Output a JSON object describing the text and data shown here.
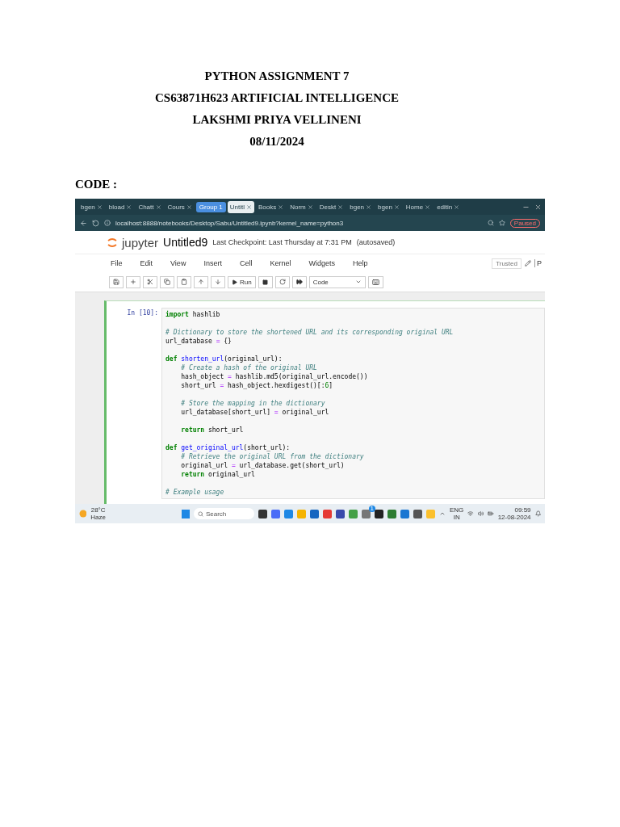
{
  "document": {
    "title_lines": [
      "PYTHON ASSIGNMENT 7",
      "CS63871H623 ARTIFICIAL INTELLIGENCE",
      "LAKSHMI PRIYA VELLINENI",
      "08/11/2024"
    ],
    "section_label": "CODE :"
  },
  "browser": {
    "group_label": "Group 1",
    "tabs": [
      {
        "label": "bgen",
        "selected": false
      },
      {
        "label": "bload",
        "selected": false
      },
      {
        "label": "Chatt",
        "selected": false
      },
      {
        "label": "Cours",
        "selected": false
      },
      {
        "label": "Untitl",
        "selected": true
      },
      {
        "label": "Books",
        "selected": false
      },
      {
        "label": "Norm",
        "selected": false
      },
      {
        "label": "Deskt",
        "selected": false
      },
      {
        "label": "bgen",
        "selected": false
      },
      {
        "label": "bgen",
        "selected": false
      },
      {
        "label": "Home",
        "selected": false
      },
      {
        "label": "editin",
        "selected": false
      }
    ],
    "url": "localhost:8888/notebooks/Desktop/Sabu/Untitled9.ipynb?kernel_name=python3",
    "profile_label": "Paused"
  },
  "notebook": {
    "logo_text": "jupyter",
    "name": "Untitled9",
    "checkpoint": "Last Checkpoint: Last Thursday at 7:31 PM",
    "autosave": "(autosaved)",
    "menu": [
      "File",
      "Edit",
      "View",
      "Insert",
      "Cell",
      "Kernel",
      "Widgets",
      "Help"
    ],
    "run_label": "Run",
    "cell_type": "Code",
    "trusted": "Trusted",
    "kernel_partial": "P",
    "cell": {
      "prompt": "In [10]:",
      "lines": [
        {
          "kind": "code",
          "segments": [
            {
              "t": "import",
              "kind": "keyword"
            },
            {
              "t": " hashlib",
              "kind": "plain"
            }
          ]
        },
        {
          "kind": "blank"
        },
        {
          "kind": "code",
          "segments": [
            {
              "t": "# Dictionary to store the shortened URL and its corresponding original URL",
              "kind": "comment"
            }
          ]
        },
        {
          "kind": "code",
          "segments": [
            {
              "t": "url_database ",
              "kind": "plain"
            },
            {
              "t": "=",
              "kind": "operator"
            },
            {
              "t": " {}",
              "kind": "plain"
            }
          ]
        },
        {
          "kind": "blank"
        },
        {
          "kind": "code",
          "segments": [
            {
              "t": "def",
              "kind": "keyword"
            },
            {
              "t": " shorten_url",
              "kind": "function"
            },
            {
              "t": "(original_url):",
              "kind": "plain"
            }
          ]
        },
        {
          "kind": "code",
          "segments": [
            {
              "t": "    # Create a hash of the original URL",
              "kind": "comment"
            }
          ]
        },
        {
          "kind": "code",
          "segments": [
            {
              "t": "    hash_object ",
              "kind": "plain"
            },
            {
              "t": "=",
              "kind": "operator"
            },
            {
              "t": " hashlib.md5(original_url.encode())",
              "kind": "plain"
            }
          ]
        },
        {
          "kind": "code",
          "segments": [
            {
              "t": "    short_url ",
              "kind": "plain"
            },
            {
              "t": "=",
              "kind": "operator"
            },
            {
              "t": " hash_object.hexdigest()[:",
              "kind": "plain"
            },
            {
              "t": "6",
              "kind": "number"
            },
            {
              "t": "]",
              "kind": "plain"
            }
          ]
        },
        {
          "kind": "blank"
        },
        {
          "kind": "code",
          "segments": [
            {
              "t": "    # Store the mapping in the dictionary",
              "kind": "comment"
            }
          ]
        },
        {
          "kind": "code",
          "segments": [
            {
              "t": "    url_database[short_url] ",
              "kind": "plain"
            },
            {
              "t": "=",
              "kind": "operator"
            },
            {
              "t": " original_url",
              "kind": "plain"
            }
          ]
        },
        {
          "kind": "blank"
        },
        {
          "kind": "code",
          "segments": [
            {
              "t": "    return",
              "kind": "keyword"
            },
            {
              "t": " short_url",
              "kind": "plain"
            }
          ]
        },
        {
          "kind": "blank"
        },
        {
          "kind": "code",
          "segments": [
            {
              "t": "def",
              "kind": "keyword"
            },
            {
              "t": " get_original_url",
              "kind": "function"
            },
            {
              "t": "(short_url):",
              "kind": "plain"
            }
          ]
        },
        {
          "kind": "code",
          "segments": [
            {
              "t": "    # Retrieve the original URL from the dictionary",
              "kind": "comment"
            }
          ]
        },
        {
          "kind": "code",
          "segments": [
            {
              "t": "    original_url ",
              "kind": "plain"
            },
            {
              "t": "=",
              "kind": "operator"
            },
            {
              "t": " url_database.get(short_url)",
              "kind": "plain"
            }
          ]
        },
        {
          "kind": "code",
          "segments": [
            {
              "t": "    return",
              "kind": "keyword"
            },
            {
              "t": " original_url",
              "kind": "plain"
            }
          ]
        },
        {
          "kind": "blank"
        },
        {
          "kind": "code",
          "segments": [
            {
              "t": "# Example usage",
              "kind": "comment"
            }
          ]
        }
      ]
    }
  },
  "taskbar": {
    "temperature": "28°C",
    "weather": "Haze",
    "search_placeholder": "Search",
    "language": "ENG",
    "region": "IN",
    "time": "09:59",
    "date": "12-08-2024",
    "notification_count": "1"
  }
}
